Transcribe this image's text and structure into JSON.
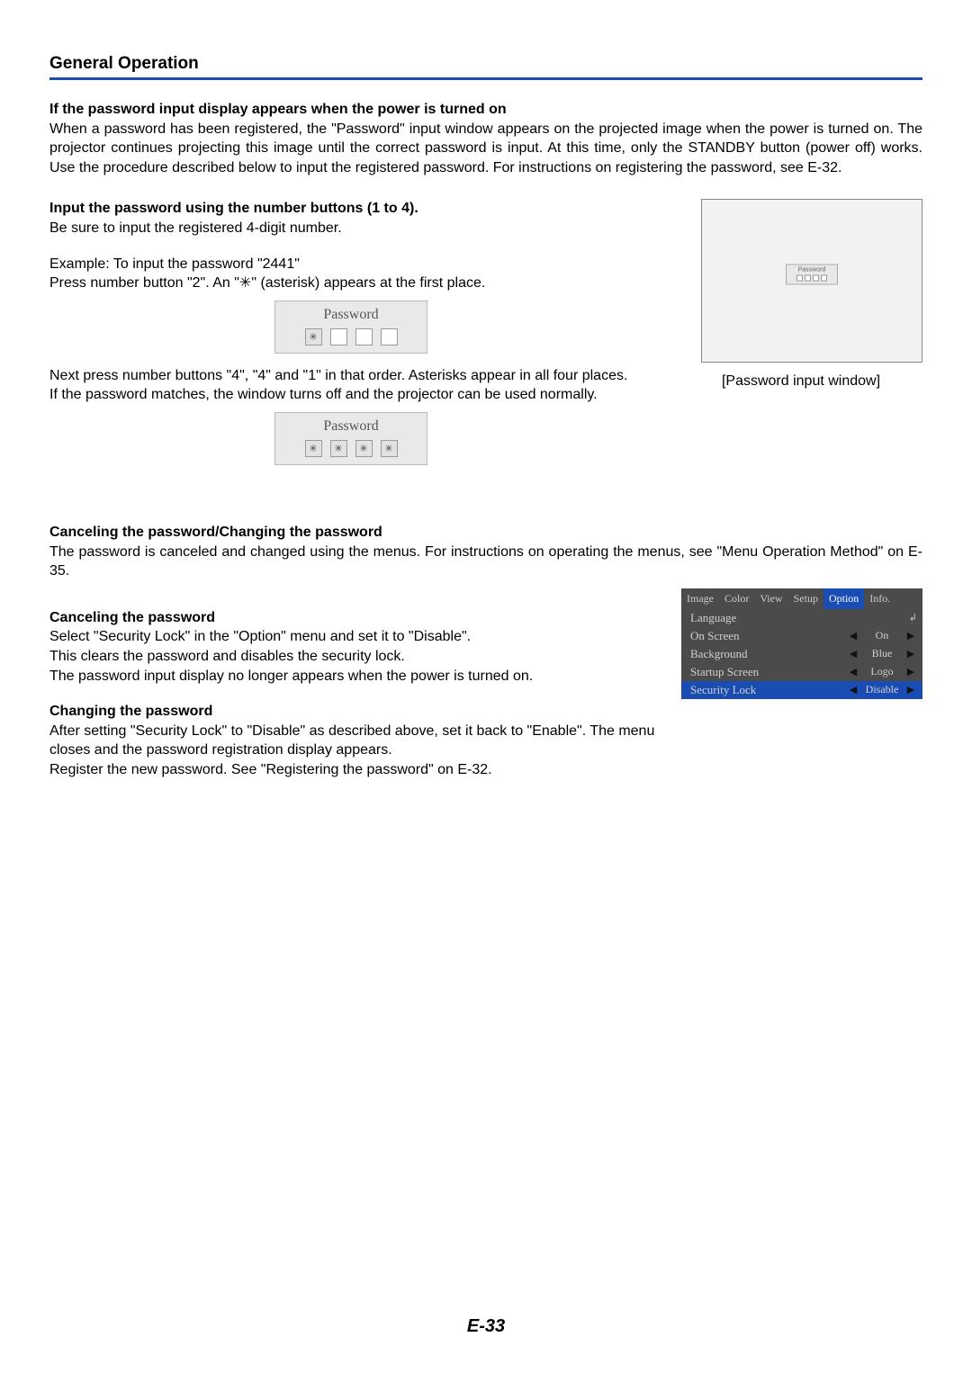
{
  "section_title": "General Operation",
  "intro": {
    "heading": "If the password input display appears when the power is turned on",
    "body": "When a password has been registered, the \"Password\" input window appears on the projected image when the power is turned on. The projector continues projecting this image until the correct password is input. At this time, only the STANDBY button (power off) works. Use the procedure described below to input the registered password. For instructions on registering the password, see E-32."
  },
  "input_pw": {
    "heading": "Input the password using the number buttons (1 to 4).",
    "line1": "Be sure to input the registered 4-digit number.",
    "example_label": "Example: To input the password \"2441\"",
    "press2": "Press number button \"2\". An \"✳\" (asterisk) appears at the first place.",
    "next_press": "Next press number buttons \"4\", \"4\" and \"1\" in that order. Asterisks appear in all four places.",
    "match": "If the password matches, the window turns off and the projector can be used normally."
  },
  "password_panel": {
    "title": "Password",
    "asterisk": "✳"
  },
  "big_caption": "[Password input window]",
  "cancel_change": {
    "heading": "Canceling the password/Changing the password",
    "body": "The password is canceled and changed using the menus. For instructions on operating the menus, see \"Menu Operation Method\" on E-35."
  },
  "cancel": {
    "heading": "Canceling the password",
    "l1": "Select \"Security Lock\" in the \"Option\" menu and set it to \"Disable\".",
    "l2": "This clears the password and disables the security lock.",
    "l3": "The password input display no longer appears when the power is turned on."
  },
  "change": {
    "heading": "Changing the password",
    "l1": "After setting \"Security Lock\" to \"Disable\" as described above, set it back to \"Enable\". The menu closes and the password registration display appears.",
    "l2": "Register the new password. See \"Registering the password\" on E-32."
  },
  "osd": {
    "tabs": [
      "Image",
      "Color",
      "View",
      "Setup",
      "Option",
      "Info."
    ],
    "active_tab": 4,
    "rows": [
      {
        "label": "Language",
        "value": "",
        "icon": "↲",
        "arrows": false
      },
      {
        "label": "On Screen",
        "value": "On",
        "arrows": true
      },
      {
        "label": "Background",
        "value": "Blue",
        "arrows": true
      },
      {
        "label": "Startup Screen",
        "value": "Logo",
        "arrows": true
      },
      {
        "label": "Security Lock",
        "value": "Disable",
        "arrows": true,
        "selected": true
      }
    ],
    "arrow_left": "◀",
    "arrow_right": "▶"
  },
  "page_number": "E-33"
}
